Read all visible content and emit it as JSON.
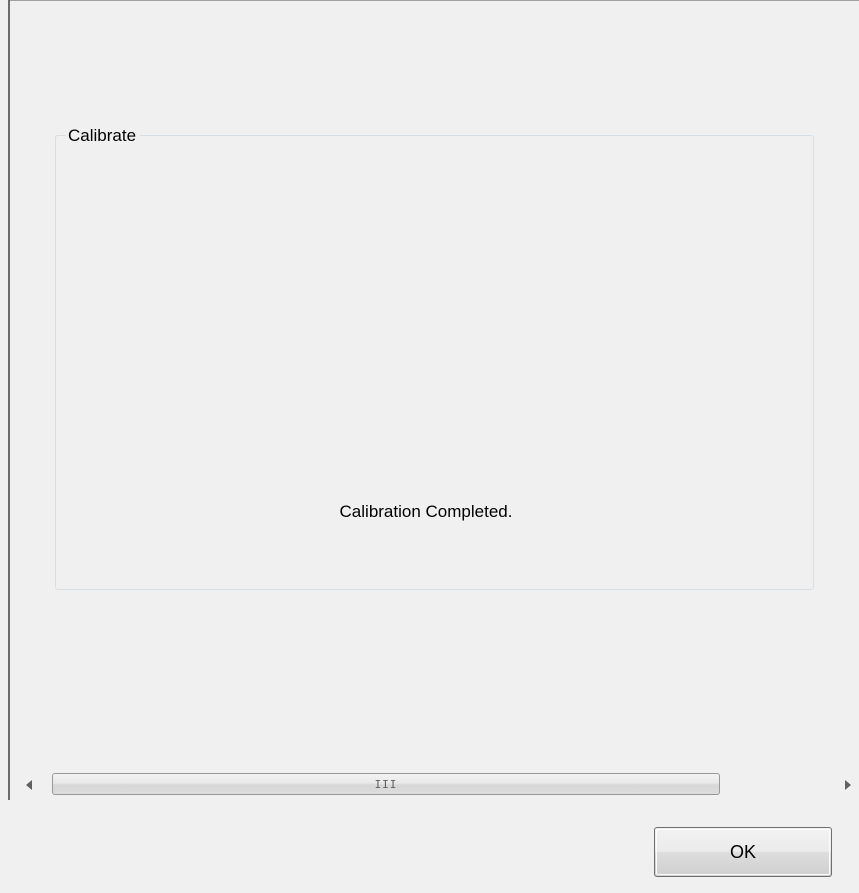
{
  "groupbox": {
    "title": "Calibrate",
    "status": "Calibration Completed."
  },
  "scrollbar": {
    "left_arrow_icon": "triangle-left",
    "right_arrow_icon": "triangle-right",
    "grip_icon": "grip-lines",
    "grip_glyph": "III"
  },
  "footer": {
    "ok_label": "OK"
  },
  "colors": {
    "background": "#f0f0f0",
    "groupbox_border": "#d5dfe5",
    "button_border": "#707070"
  }
}
